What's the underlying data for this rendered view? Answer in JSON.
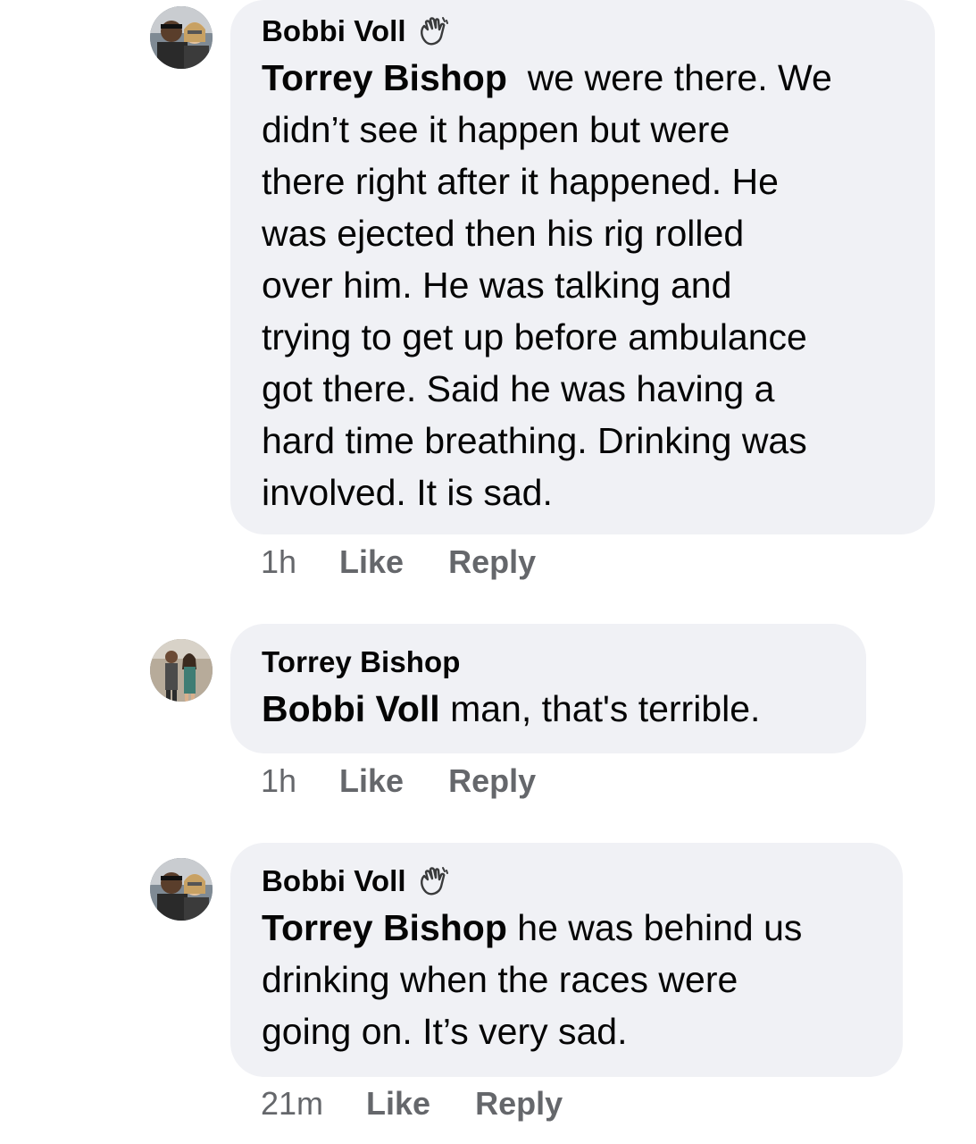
{
  "comments": [
    {
      "author": "Bobbi Voll",
      "author_badge_icon": "wave-icon",
      "mention": "Torrey Bishop",
      "text_lines": [
        "we were there. We",
        "didn’t see it happen but were",
        "there right after it happened. He",
        "was ejected then his rig rolled",
        "over him. He was talking and",
        "trying to get up before ambulance",
        "got there. Said he was having a",
        "hard time breathing. Drinking was",
        "involved. It is sad."
      ],
      "time": "1h",
      "like_label": "Like",
      "reply_label": "Reply"
    },
    {
      "author": "Torrey Bishop",
      "mention": "Bobbi Voll",
      "text_lines": [
        "man, that's terrible."
      ],
      "time": "1h",
      "like_label": "Like",
      "reply_label": "Reply"
    },
    {
      "author": "Bobbi Voll",
      "author_badge_icon": "wave-icon",
      "mention": "Torrey Bishop",
      "text_lines": [
        "he was behind us",
        "drinking when the races were",
        "going on. It’s very sad."
      ],
      "time": "21m",
      "like_label": "Like",
      "reply_label": "Reply"
    }
  ],
  "colors": {
    "bubble_bg": "#f0f1f5",
    "text": "#050505",
    "meta": "#65676b"
  }
}
